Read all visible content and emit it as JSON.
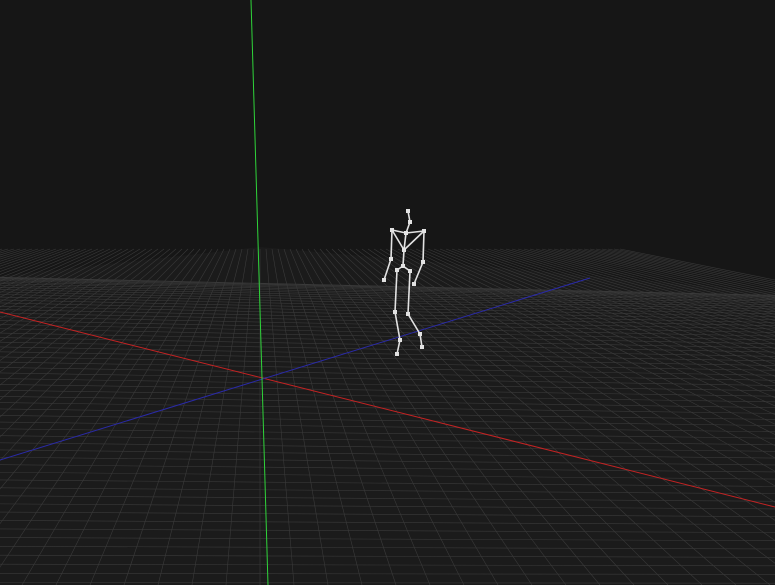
{
  "viewport": {
    "background_color": "#161616",
    "floor_color": "#1b1b1b",
    "grid_line_color": "#3a3a3a",
    "x_axis_color": "#c42323",
    "y_axis_color": "#2fd43a",
    "z_axis_color": "#2a2aa8",
    "skeleton_color": "#e2e2e2",
    "skeleton_label": "skeleton-figure"
  }
}
